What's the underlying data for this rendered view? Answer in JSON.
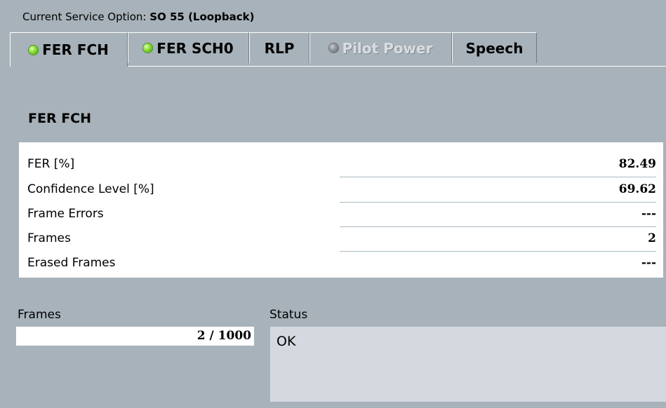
{
  "header": {
    "prefix": "Current Service Option: ",
    "value": "SO 55 (Loopback)"
  },
  "tabs": [
    {
      "label": "FER FCH",
      "led": "green",
      "active": true,
      "enabled": true,
      "icon": "status-led-green-icon"
    },
    {
      "label": "FER SCH0",
      "led": "green",
      "active": false,
      "enabled": true,
      "icon": "status-led-green-icon"
    },
    {
      "label": "RLP",
      "led": "",
      "active": false,
      "enabled": true,
      "icon": ""
    },
    {
      "label": "Pilot Power",
      "led": "grey",
      "active": false,
      "enabled": false,
      "icon": "status-led-grey-icon"
    },
    {
      "label": "Speech",
      "led": "",
      "active": false,
      "enabled": true,
      "icon": ""
    }
  ],
  "section": {
    "title": "FER FCH"
  },
  "results": {
    "rows": [
      {
        "label": "FER [%]",
        "value": "82.49"
      },
      {
        "label": "Confidence Level [%]",
        "value": "69.62"
      },
      {
        "label": "Frame Errors",
        "value": "---"
      },
      {
        "label": "Frames",
        "value": "2"
      },
      {
        "label": "Erased Frames",
        "value": "---"
      }
    ]
  },
  "frames": {
    "label": "Frames",
    "value": "2 / 1000",
    "current": 2,
    "total": 1000
  },
  "status": {
    "label": "Status",
    "text": "OK"
  },
  "colors": {
    "background": "#a7b2ba",
    "panel": "#ffffff",
    "status_box": "#d3d9df",
    "led_green": "#6ccf2a",
    "led_grey": "#8d9399"
  }
}
